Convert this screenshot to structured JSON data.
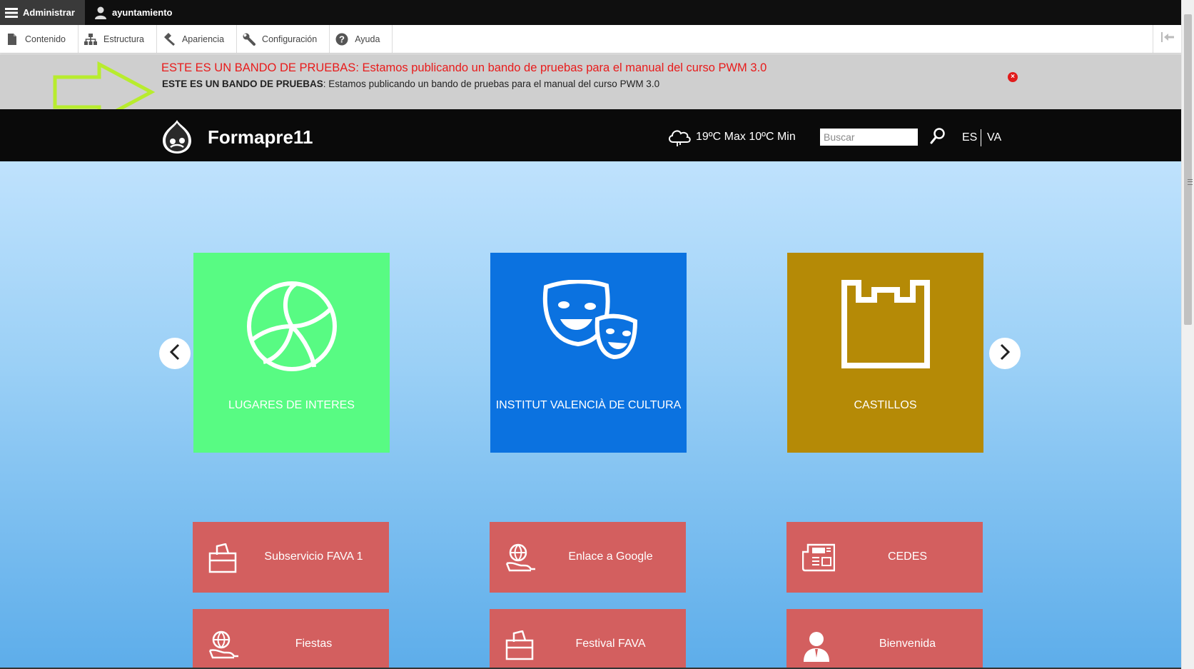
{
  "admin_bar": {
    "manage_label": "Administrar",
    "user_label": "ayuntamiento"
  },
  "toolbar": {
    "items": [
      {
        "label": "Contenido",
        "icon": "file-icon"
      },
      {
        "label": "Estructura",
        "icon": "sitemap-icon"
      },
      {
        "label": "Apariencia",
        "icon": "paint-icon"
      },
      {
        "label": "Configuración",
        "icon": "wrench-icon"
      },
      {
        "label": "Ayuda",
        "icon": "help-icon"
      }
    ]
  },
  "announcement": {
    "title": "ESTE ES UN BANDO DE PRUEBAS: Estamos publicando un bando de pruebas para el manual del curso PWM 3.0",
    "body_bold": "ESTE ES UN BANDO DE PRUEBAS",
    "body_text": ": Estamos publicando un bando de pruebas para el manual del curso PWM 3.0",
    "accent_color": "#e81b1b",
    "arrow_color": "#b3e82f"
  },
  "header": {
    "site_name": "Formapre11",
    "weather": "19ºC Max 10ºC Min",
    "search_placeholder": "Buscar",
    "lang_es": "ES",
    "lang_va": "VA"
  },
  "carousel": {
    "tiles": [
      {
        "label": "LUGARES DE INTERES",
        "color": "#58fb83",
        "icon": "volleyball-icon"
      },
      {
        "label": "INSTITUT VALENCIÀ DE CULTURA",
        "color": "#0b72e0",
        "icon": "theater-masks-icon"
      },
      {
        "label": "CASTILLOS",
        "color": "#b58a06",
        "icon": "castle-icon"
      }
    ]
  },
  "services": {
    "color": "#d35f5f",
    "items": [
      {
        "label": "Subservicio FAVA 1",
        "icon": "ballot-box-icon"
      },
      {
        "label": "Enlace a Google",
        "icon": "globe-hand-icon"
      },
      {
        "label": "CEDES",
        "icon": "newspaper-icon"
      },
      {
        "label": "Fiestas",
        "icon": "globe-hand-icon"
      },
      {
        "label": "Festival FAVA",
        "icon": "ballot-box-icon"
      },
      {
        "label": "Bienvenida",
        "icon": "person-icon"
      }
    ]
  }
}
